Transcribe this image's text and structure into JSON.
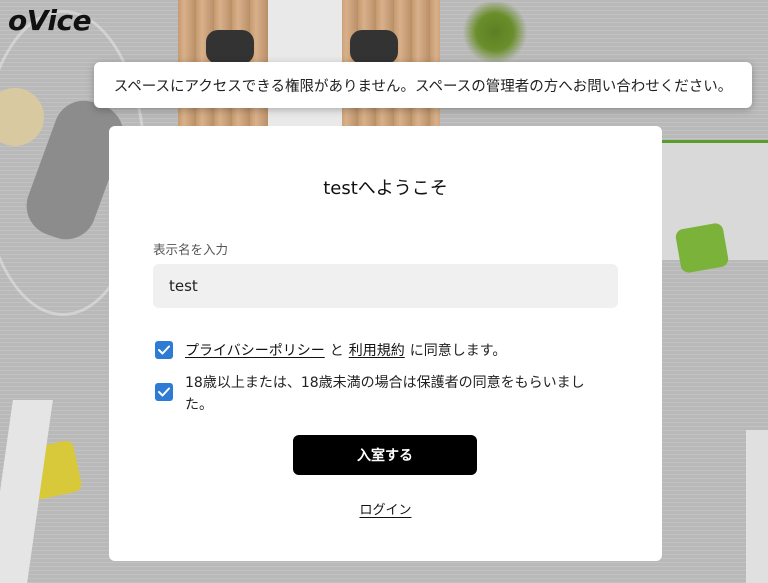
{
  "app": {
    "logo_text": "oVice"
  },
  "toast": {
    "message": "スペースにアクセスできる権限がありません。スペースの管理者の方へお問い合わせください。"
  },
  "modal": {
    "title": "testへようこそ",
    "display_name_label": "表示名を入力",
    "display_name_value": "test",
    "consent": {
      "privacy_link": "プライバシーポリシー",
      "connector": "と",
      "terms_link": "利用規約",
      "suffix": "に同意します。",
      "checked": true
    },
    "age_consent": {
      "text": "18歳以上または、18歳未満の場合は保護者の同意をもらいました。",
      "checked": true
    },
    "enter_button": "入室する",
    "login_link": "ログイン"
  },
  "colors": {
    "checkbox": "#2e7bd6",
    "primary_button": "#000000",
    "input_background": "#f0f0f0"
  }
}
